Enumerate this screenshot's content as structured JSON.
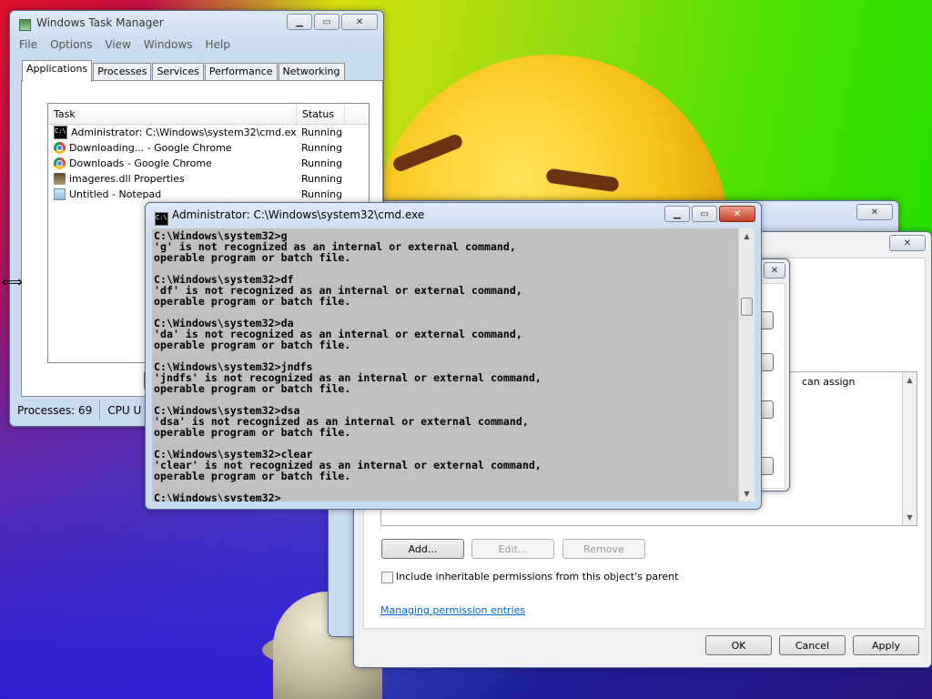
{
  "task_manager": {
    "title": "Windows Task Manager",
    "menu": [
      "File",
      "Options",
      "View",
      "Windows",
      "Help"
    ],
    "tabs": [
      "Applications",
      "Processes",
      "Services",
      "Performance",
      "Networking"
    ],
    "columns": {
      "task": "Task",
      "status": "Status"
    },
    "tasks": [
      {
        "icon": "cmd-icon",
        "name": "Administrator: C:\\Windows\\system32\\cmd.exe",
        "status": "Running"
      },
      {
        "icon": "chrome-icon",
        "name": "Downloading... - Google Chrome",
        "status": "Running"
      },
      {
        "icon": "chrome-icon",
        "name": "Downloads - Google Chrome",
        "status": "Running"
      },
      {
        "icon": "properties-icon",
        "name": "imageres.dll Properties",
        "status": "Running"
      },
      {
        "icon": "notepad-icon",
        "name": "Untitled - Notepad",
        "status": "Running"
      }
    ],
    "status_processes": "Processes: 69",
    "status_cpu": "CPU U"
  },
  "cmd": {
    "title": "Administrator: C:\\Windows\\system32\\cmd.exe",
    "icon_text": "C:\\",
    "lines": "C:\\Windows\\system32>g\n'g' is not recognized as an internal or external command,\noperable program or batch file.\n\nC:\\Windows\\system32>df\n'df' is not recognized as an internal or external command,\noperable program or batch file.\n\nC:\\Windows\\system32>da\n'da' is not recognized as an internal or external command,\noperable program or batch file.\n\nC:\\Windows\\system32>jndfs\n'jndfs' is not recognized as an internal or external command,\noperable program or batch file.\n\nC:\\Windows\\system32>dsa\n'dsa' is not recognized as an internal or external command,\noperable program or batch file.\n\nC:\\Windows\\system32>clear\n'clear' is not recognized as an internal or external command,\noperable program or batch file.\n\nC:\\Windows\\system32>"
  },
  "permissions": {
    "partial_text": "can assign",
    "add": "Add...",
    "edit": "Edit...",
    "remove": "Remove",
    "inherit_label": "Include inheritable permissions from this object's parent",
    "link": "Managing permission entries",
    "ok": "OK",
    "cancel": "Cancel",
    "apply": "Apply"
  },
  "caption_glyphs": {
    "minimize": "▁",
    "maximize": "▭",
    "close": "✕"
  }
}
